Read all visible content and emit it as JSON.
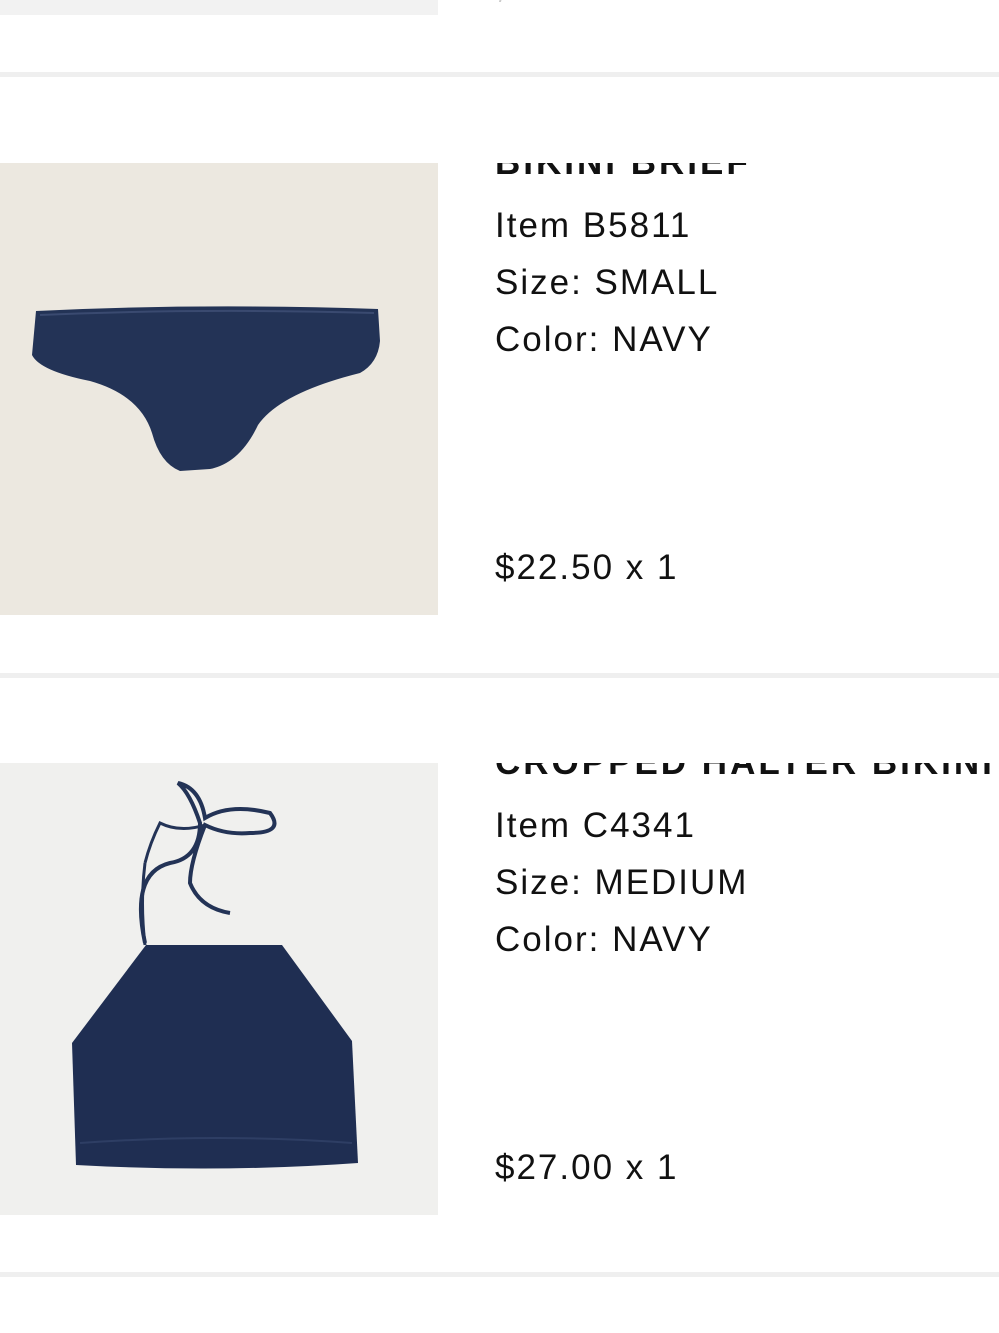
{
  "cart": {
    "items": [
      {
        "name": "BIKINI BRIEF",
        "item_label": "Item B5811",
        "size_label": "Size: SMALL",
        "color_label": "Color: NAVY",
        "price_qty": "$22.50 x 1",
        "image_bg": "#ece8e0",
        "product_color": "#233356",
        "icon": "bikini-brief-image"
      },
      {
        "name": "CROPPED HALTER BIKINI TOP",
        "item_label": "Item C4341",
        "size_label": "Size: MEDIUM",
        "color_label": "Color: NAVY",
        "price_qty": "$27.00 x 1",
        "image_bg": "#f0f0ee",
        "product_color": "#1f2e52",
        "icon": "halter-bikini-top-image"
      }
    ]
  },
  "colors": {
    "divider": "#efefef",
    "text": "#111111"
  }
}
